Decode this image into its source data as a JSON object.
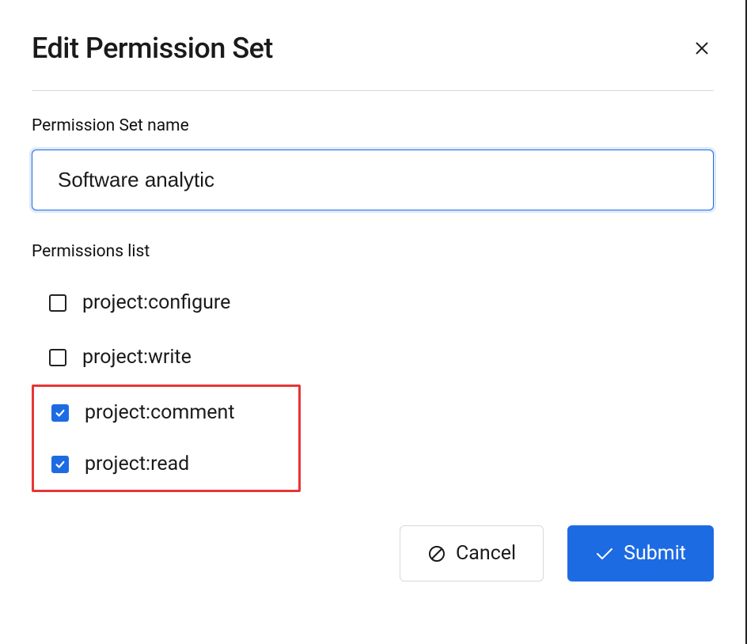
{
  "modal": {
    "title": "Edit Permission Set",
    "name_label": "Permission Set name",
    "name_value": "Software analytic",
    "permissions_label": "Permissions list",
    "permissions": [
      {
        "label": "project:configure",
        "checked": false,
        "highlighted": false
      },
      {
        "label": "project:write",
        "checked": false,
        "highlighted": false
      },
      {
        "label": "project:comment",
        "checked": true,
        "highlighted": true
      },
      {
        "label": "project:read",
        "checked": true,
        "highlighted": true
      }
    ],
    "cancel_label": "Cancel",
    "submit_label": "Submit"
  }
}
